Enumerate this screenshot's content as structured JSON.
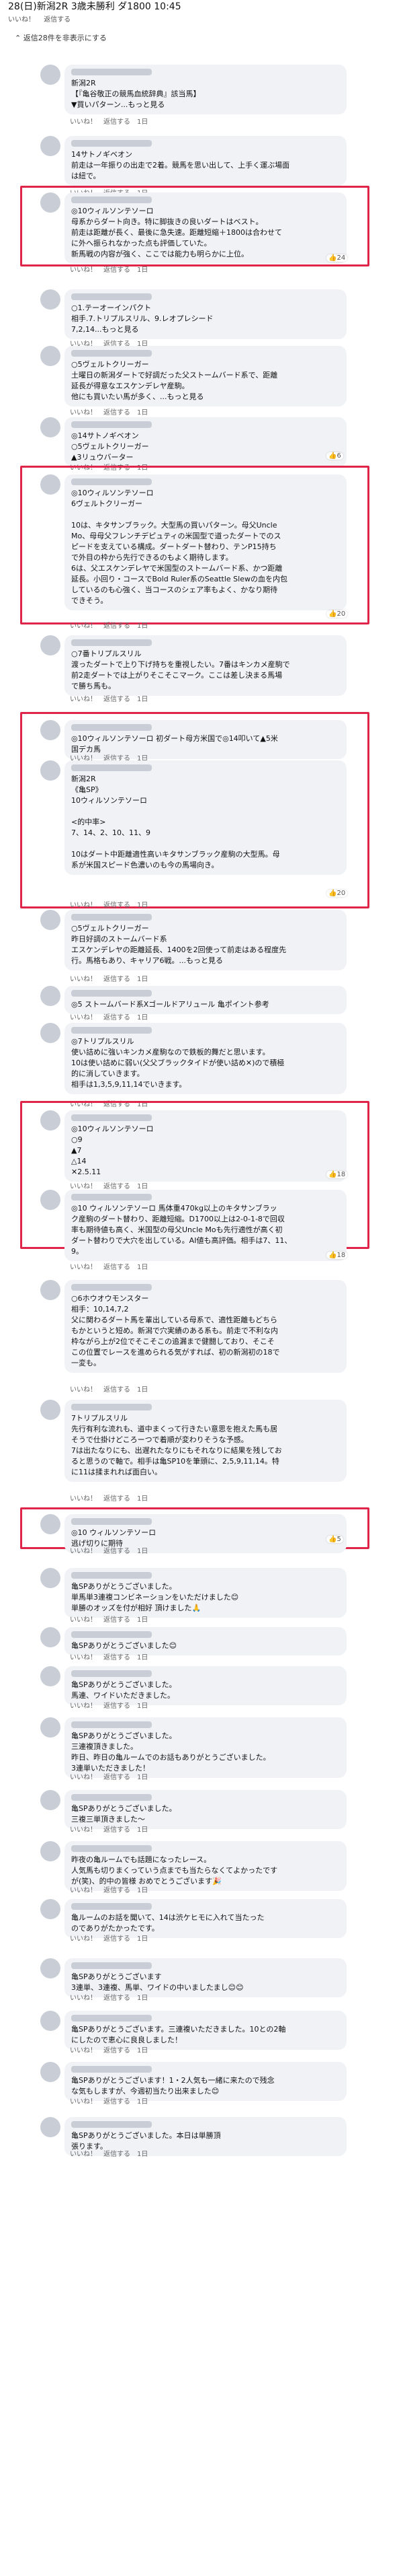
{
  "header": {
    "race_title": "28(日)新潟2R 3歳未勝利 ダ1800 10:45",
    "like_label": "いいね！",
    "reply_label": "返信する",
    "more_comments": "返信28件を非表示にする"
  },
  "comments": [
    {
      "lines": [
        "新潟2R",
        "【『亀谷敬正の競馬血統辞典』該当馬】",
        "▼買いパターン...もっと見る"
      ],
      "time": "1日"
    },
    {
      "lines": [
        "14サトノギベオン",
        "前走は一年振りの出走で2着。競馬を思い出して、上手く運ぶ場面",
        "は紐で。"
      ],
      "time": "1日"
    },
    {
      "lines": [
        "◎10ウィルソンテソーロ",
        "母系からダート向き。特に脚抜きの良いダートはベスト。",
        "前走は距離が長く、最後に急失速。距離短縮＋1800は合わせて",
        "に外へ振られなかった点も評価していた。",
        "新馬戦の内容が強く、ここでは能力も明らかに上位。"
      ],
      "time": "1日",
      "reactions": "24"
    },
    {
      "lines": [
        "○1.テーオーインパクト",
        "相手.7.トリプルスリル、9.レオプレシード",
        "7,2,14...もっと見る"
      ],
      "time": "1日"
    },
    {
      "lines": [
        "○5ヴェルトクリーガー",
        "土曜日の新潟ダートで好調だった父ストームバード系で、距離",
        "延長が得意なエスケンデレヤ産駒。",
        "他にも買いたい馬が多く、...もっと見る"
      ],
      "time": "1日"
    },
    {
      "lines": [
        "◎14サトノギベオン",
        "○5ヴェルトクリーガー",
        "▲3リュウバーター"
      ],
      "time": "1日",
      "reactions": "6"
    },
    {
      "lines": [
        "◎10ウィルソンテソーロ",
        "6ヴェルトクリーガー",
        "",
        "10は、キタサンブラック。大型馬の買いパターン。母父Uncle",
        "Mo、母母父フレンチデピュティの米国型で道ったダートでのス",
        "ピードを支えている構成。ダートダート替わり、テンP15持ち",
        "で外目の枠から先行できるのもよく期待します。",
        "6は、父エスケンデレヤで米国型のストームバード系、かつ距離",
        "延長。小回り・コースでBold Ruler系のSeattle Slewの血を内包",
        "しているのも心強く、当コースのシェア率もよく、かなり期待",
        "できそう。"
      ],
      "time": "1日",
      "reactions": "20"
    },
    {
      "lines": [
        "○7番トリプルスリル",
        "渡ったダートで上り下げ持ちを重視したい。7番はキンカメ産駒で",
        "前2走ダートでは上がりそこそこマーク。ここは差し決まる馬場",
        "で勝ち馬も。"
      ],
      "time": "1日"
    },
    {
      "lines": [
        "◎10ウィルソンテソーロ 初ダート母方米国で◎14叩いて▲5米",
        "国デカ馬"
      ],
      "time": "1日"
    },
    {
      "lines": [
        "新潟2R",
        "《亀SP》",
        "10ウィルソンテソーロ",
        "",
        "<的中率>",
        "7、14、2、10、11、9",
        "",
        "10はダート中距離適性高いキタサンブラック産駒の大型馬。母",
        "系が米国スピード色濃いのも今の馬場向き。"
      ],
      "time": "1日",
      "reactions": "20"
    },
    {
      "lines": [
        "○5ヴェルトクリーガー",
        "昨日好調のストームバード系",
        "エスケンデレヤの距離延長、1400を2回使って前走はある程度先",
        "行。馬格もあり、キャリア6戦。...もっと見る"
      ],
      "time": "1日"
    },
    {
      "lines": [
        "◎5 ストームバード系Xゴールドアリュール 亀ポイント参考"
      ],
      "time": "1日"
    },
    {
      "lines": [
        "◎7トリプルスリル",
        "使い詰めに強いキンカメ産駒なので鉄板的舞だと思います。",
        "10は使い詰めに弱い(父父ブラックタイドが使い詰め✕)ので積極",
        "的に消していきます。",
        "相手は1,3,5,9,11,14でいきます。"
      ],
      "time": "1日"
    },
    {
      "lines": [
        "◎10ウィルソンテソーロ",
        "○9",
        "▲7",
        "△14",
        "✕2.5.11"
      ],
      "time": "1日",
      "reactions": "18"
    },
    {
      "lines": [
        "◎10 ウィルソンテソーロ 馬体重470kg以上のキタサンブラッ",
        "ク産駒のダート替わり、距離短縮。D1700以上は2-0-1-8で回収",
        "率も期待値も高く、米国型の母父Uncle Moも先行適性が高く初",
        "ダート替わりで大穴を出している。AI値も高評価。相手は7、11、",
        "9。"
      ],
      "time": "1日",
      "reactions": "18"
    },
    {
      "lines": [
        "○6ホウオウモンスター",
        "相手：10,14,7,2",
        "父に関わるダート馬を輩出している母系で、適性距離もどちら",
        "もかというと短め。新潟で穴実績のある系も。前走で不利な内",
        "枠ながら上が2位でそこそこの追漏まで健闘しており、そこそ",
        "この位置でレースを進められる気がすれば、初の新潟初の18で",
        "一変も。"
      ],
      "time": "1日"
    },
    {
      "lines": [
        "7トリプルスリル",
        "先行有利な流れも、道中まくって行きたい意思を抱えた馬も居",
        "そうで仕掛けどころーつで着順が変わりそうな予感。",
        "7は出たなりにも、出遅れたなりにもそれなりに結果を残してお",
        "ると思うので軸で。相手は亀SP10を筆頭に、2,5,9,11,14。特",
        "に11は揉まれれば面白い。"
      ],
      "time": "1日"
    },
    {
      "lines": [
        "◎10 ウィルソンテソーロ",
        "逃げ切りに期待"
      ],
      "time": "1日",
      "reactions": "5"
    },
    {
      "lines": [
        "亀SPありがとうございました。",
        "単馬単3連複コンビネーションをいただけました😊",
        "単勝のオッズを付が相好 頂けました🙏"
      ],
      "time": "1日"
    },
    {
      "lines": [
        "亀SPありがとうございました😊"
      ],
      "time": "1日"
    },
    {
      "lines": [
        "亀SPありがとうございました。",
        "馬連、ワイドいただきました。"
      ],
      "time": "1日"
    },
    {
      "lines": [
        "亀SPありがとうございました。",
        "三連複頂きました。",
        "昨日、昨日の亀ルームでのお話もありがとうございました。",
        "3連単いただきました！"
      ],
      "time": "1日"
    },
    {
      "lines": [
        "亀SPありがとうございました。",
        "三複三単頂きました～"
      ],
      "time": "1日"
    },
    {
      "lines": [
        "昨夜の亀ルームでも話題になったレース。",
        "人気馬も切りまくっていう点までも当たらなくてよかったです",
        "が(笑)、的中の皆様 おめでとうございます🎉"
      ],
      "time": "1日"
    },
    {
      "lines": [
        "亀ルームのお話を聞いて、14は渋ケヒモに入れて当たった",
        "のでありがたかったです。"
      ],
      "time": "1日"
    },
    {
      "lines": [
        "亀SPありがとうございます",
        "3連単、3連複、馬単、ワイドの中いましたまし😊😊"
      ],
      "time": "1日"
    },
    {
      "lines": [
        "亀SPありがとうございます。三連複いただきました。10との2軸",
        "にしたので恵心に良良しました！"
      ],
      "time": "1日"
    },
    {
      "lines": [
        "亀SPありがとうございます！1・2人気も一緒に来たので残念",
        "な気もしますが、今週初当たり出来ました😊"
      ],
      "time": "1日"
    },
    {
      "lines": [
        "亀SPありがとうございました。本日は単勝頂",
        "張ります。"
      ],
      "time": "1日"
    }
  ]
}
